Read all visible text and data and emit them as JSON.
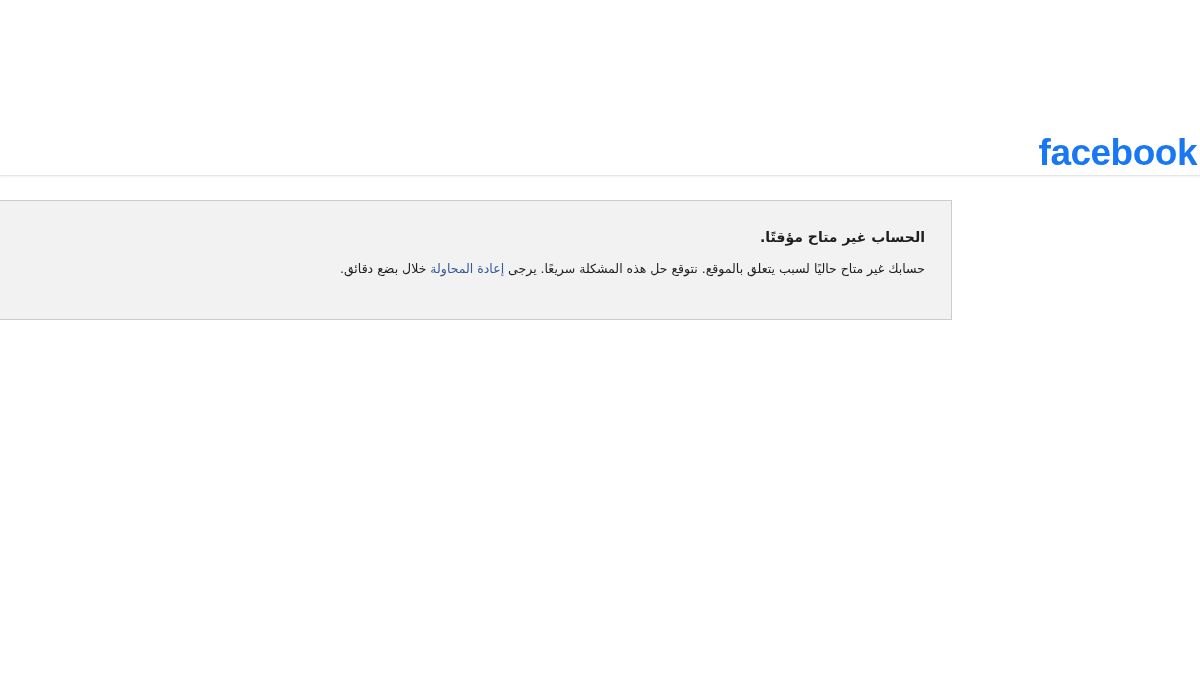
{
  "header": {
    "logo": "facebook"
  },
  "notice": {
    "title": "الحساب غير متاح مؤقتًا.",
    "message": {
      "before": "حسابك غير متاح حاليًا لسبب يتعلق بالموقع. نتوقع حل هذه المشكلة سريعًا. يرجى ",
      "link": "إعادة المحاولة",
      "after": " خلال بضع دقائق."
    }
  }
}
